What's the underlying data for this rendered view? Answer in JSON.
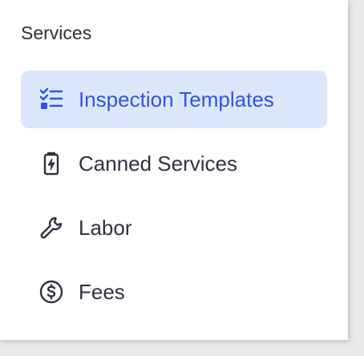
{
  "sidebar": {
    "section_title": "Services",
    "accent_color": "#2f54e6",
    "active_bg": "#dde7fb",
    "items": [
      {
        "label": "Inspection Templates",
        "icon": "checklist-icon",
        "active": true
      },
      {
        "label": "Canned Services",
        "icon": "battery-bolt-icon",
        "active": false
      },
      {
        "label": "Labor",
        "icon": "wrench-icon",
        "active": false
      },
      {
        "label": "Fees",
        "icon": "dollar-circle-icon",
        "active": false
      }
    ]
  }
}
